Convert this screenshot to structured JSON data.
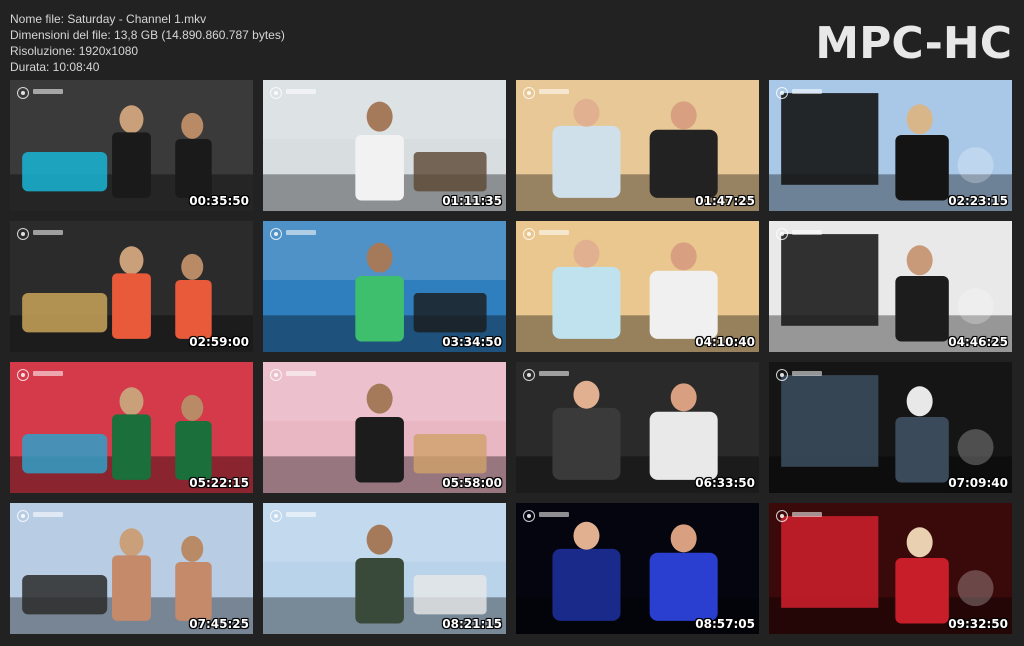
{
  "file_info": {
    "name": "Nome file: Saturday - Channel 1.mkv",
    "size": "Dimensioni del file: 13,8 GB (14.890.860.787 bytes)",
    "resolution": "Risoluzione: 1920x1080",
    "duration": "Durata: 10:08:40"
  },
  "logo": "MPC-HC",
  "thumbnails": [
    {
      "time": "00:35:50",
      "colors": {
        "bg": "#3a3a3a",
        "main": "#1a1a1a",
        "accent": "#19b6d6"
      }
    },
    {
      "time": "01:11:35",
      "colors": {
        "bg": "#d8dde0",
        "main": "#f2f2f2",
        "accent": "#5a4632"
      }
    },
    {
      "time": "01:47:25",
      "colors": {
        "bg": "#e8c896",
        "main": "#cfe0ea",
        "accent": "#222222"
      }
    },
    {
      "time": "02:23:15",
      "colors": {
        "bg": "#a9c8e8",
        "main": "#141414",
        "accent": "#d9b58a"
      }
    },
    {
      "time": "02:59:00",
      "colors": {
        "bg": "#2b2b2b",
        "main": "#e85a3a",
        "accent": "#c9a45a"
      }
    },
    {
      "time": "03:34:50",
      "colors": {
        "bg": "#2f7fbf",
        "main": "#3dbf6e",
        "accent": "#1a1a1a"
      }
    },
    {
      "time": "04:10:40",
      "colors": {
        "bg": "#e9c78e",
        "main": "#bfe2ee",
        "accent": "#f0f0f0"
      }
    },
    {
      "time": "04:46:25",
      "colors": {
        "bg": "#e9e9e9",
        "main": "#1c1c1c",
        "accent": "#c99a7a"
      }
    },
    {
      "time": "05:22:15",
      "colors": {
        "bg": "#d43a4a",
        "main": "#1a6f3a",
        "accent": "#2fa0c8"
      }
    },
    {
      "time": "05:58:00",
      "colors": {
        "bg": "#e9b6c4",
        "main": "#1c1c1c",
        "accent": "#cfa36a"
      }
    },
    {
      "time": "06:33:50",
      "colors": {
        "bg": "#2a2a2a",
        "main": "#3a3a3a",
        "accent": "#e9e9e9"
      }
    },
    {
      "time": "07:09:40",
      "colors": {
        "bg": "#151515",
        "main": "#3a4a5a",
        "accent": "#e8e8e8"
      }
    },
    {
      "time": "07:45:25",
      "colors": {
        "bg": "#b8cde4",
        "main": "#c48a6a",
        "accent": "#2a2a2a"
      }
    },
    {
      "time": "08:21:15",
      "colors": {
        "bg": "#b9d3ea",
        "main": "#3a4a3a",
        "accent": "#e8e8e8"
      }
    },
    {
      "time": "08:57:05",
      "colors": {
        "bg": "#050510",
        "main": "#1a2a8a",
        "accent": "#2a3fd0"
      }
    },
    {
      "time": "09:32:50",
      "colors": {
        "bg": "#3a0a0a",
        "main": "#c81e2a",
        "accent": "#e8d0b0"
      }
    }
  ]
}
